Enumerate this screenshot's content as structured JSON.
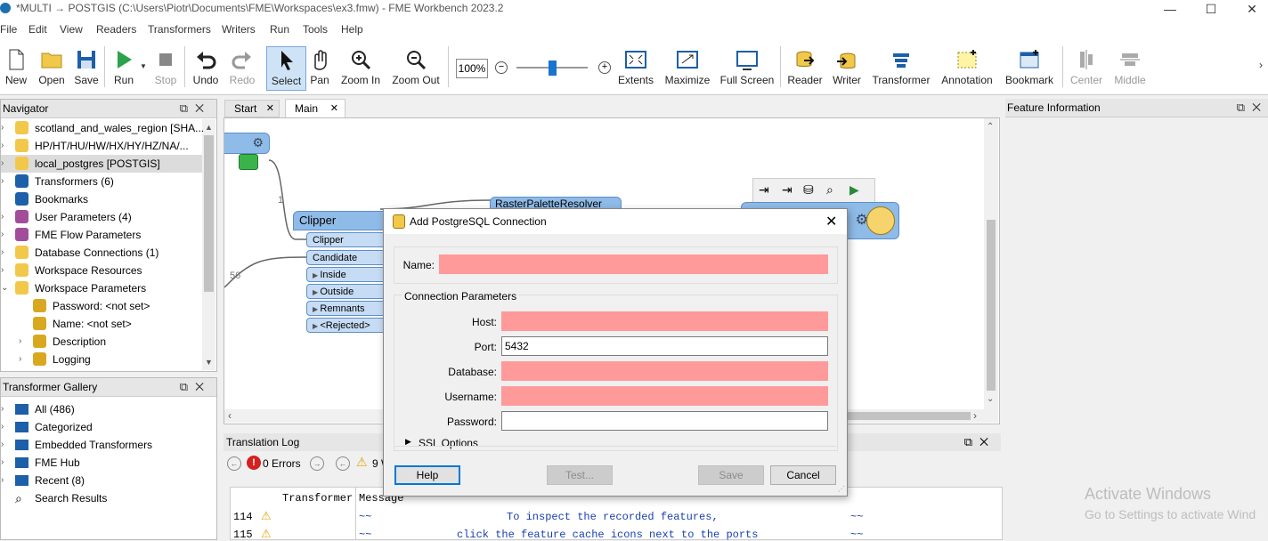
{
  "window": {
    "title": "*MULTI → POSTGIS (C:\\Users\\Piotr\\Documents\\FME\\Workspaces\\ex3.fmw) - FME Workbench 2023.2",
    "minimize": "—",
    "maximize": "☐",
    "close": "✕"
  },
  "menu": [
    "File",
    "Edit",
    "View",
    "Readers",
    "Transformers",
    "Writers",
    "Run",
    "Tools",
    "Help"
  ],
  "toolbar": {
    "new": "New",
    "open": "Open",
    "save": "Save",
    "run": "Run",
    "stop": "Stop",
    "undo": "Undo",
    "redo": "Redo",
    "select": "Select",
    "pan": "Pan",
    "zoom_in": "Zoom In",
    "zoom_out": "Zoom Out",
    "zoom_level": "100%",
    "zoom_slider": 0.5,
    "extents": "Extents",
    "maximize": "Maximize",
    "full_screen": "Full Screen",
    "reader": "Reader",
    "writer": "Writer",
    "transformer": "Transformer",
    "annotation": "Annotation",
    "bookmark": "Bookmark",
    "center": "Center",
    "middle": "Middle"
  },
  "navigator": {
    "title": "Navigator",
    "items": [
      {
        "label": "scotland_and_wales_region [SHA..."
      },
      {
        "label": "HP/HT/HU/HW/HX/HY/HZ/NA/..."
      },
      {
        "label": "local_postgres [POSTGIS]"
      },
      {
        "label": "Transformers (6)"
      },
      {
        "label": "Bookmarks"
      },
      {
        "label": "User Parameters (4)"
      },
      {
        "label": "FME Flow Parameters"
      },
      {
        "label": "Database Connections (1)"
      },
      {
        "label": "Workspace Resources"
      },
      {
        "label": "Workspace Parameters"
      },
      {
        "label": "Password: <not set>"
      },
      {
        "label": "Name: <not set>"
      },
      {
        "label": "Description"
      },
      {
        "label": "Logging"
      }
    ]
  },
  "gallery": {
    "title": "Transformer Gallery",
    "items": [
      {
        "label": "All (486)"
      },
      {
        "label": "Categorized"
      },
      {
        "label": "Embedded Transformers"
      },
      {
        "label": "FME Hub"
      },
      {
        "label": "Recent (8)"
      },
      {
        "label": "Search Results"
      }
    ]
  },
  "tabs": {
    "start": "Start",
    "main": "Main",
    "close": "✕"
  },
  "canvas": {
    "clipper_title": "Clipper",
    "ports": [
      "Clipper",
      "Candidate",
      "Inside",
      "Outside",
      "Remnants",
      "<Rejected>"
    ],
    "link_count_1": "1",
    "link_count_2": "56",
    "raster_node": "RasterPaletteResolver"
  },
  "feature_info": {
    "title": "Feature Information"
  },
  "dialog": {
    "title": "Add PostgreSQL Connection",
    "name_label": "Name:",
    "name_value": "",
    "section_title": "Connection Parameters",
    "host_label": "Host:",
    "host_value": "",
    "port_label": "Port:",
    "port_value": "5432",
    "database_label": "Database:",
    "database_value": "",
    "username_label": "Username:",
    "username_value": "",
    "password_label": "Password:",
    "password_value": "",
    "ssl_label": "SSL Options",
    "help": "Help",
    "test": "Test...",
    "save": "Save",
    "cancel": "Cancel"
  },
  "log": {
    "title": "Translation Log",
    "errors": "0 Errors",
    "warnings": "9 W",
    "col_transformer": "Transformer",
    "col_message": "Message",
    "rows": [
      {
        "line": "114",
        "dash": "~~",
        "msg": "To inspect the recorded features,",
        "tail": "~~"
      },
      {
        "line": "115",
        "dash": "~~",
        "msg": "click the feature cache icons next to the ports",
        "tail": "~~"
      }
    ]
  },
  "watermark": {
    "line1": "Activate Windows",
    "line2": "Go to Settings to activate Wind"
  },
  "colors": {
    "required_field": "#ff9a9a",
    "port_fill": "#c6dcf5",
    "accent": "#0078d7"
  }
}
